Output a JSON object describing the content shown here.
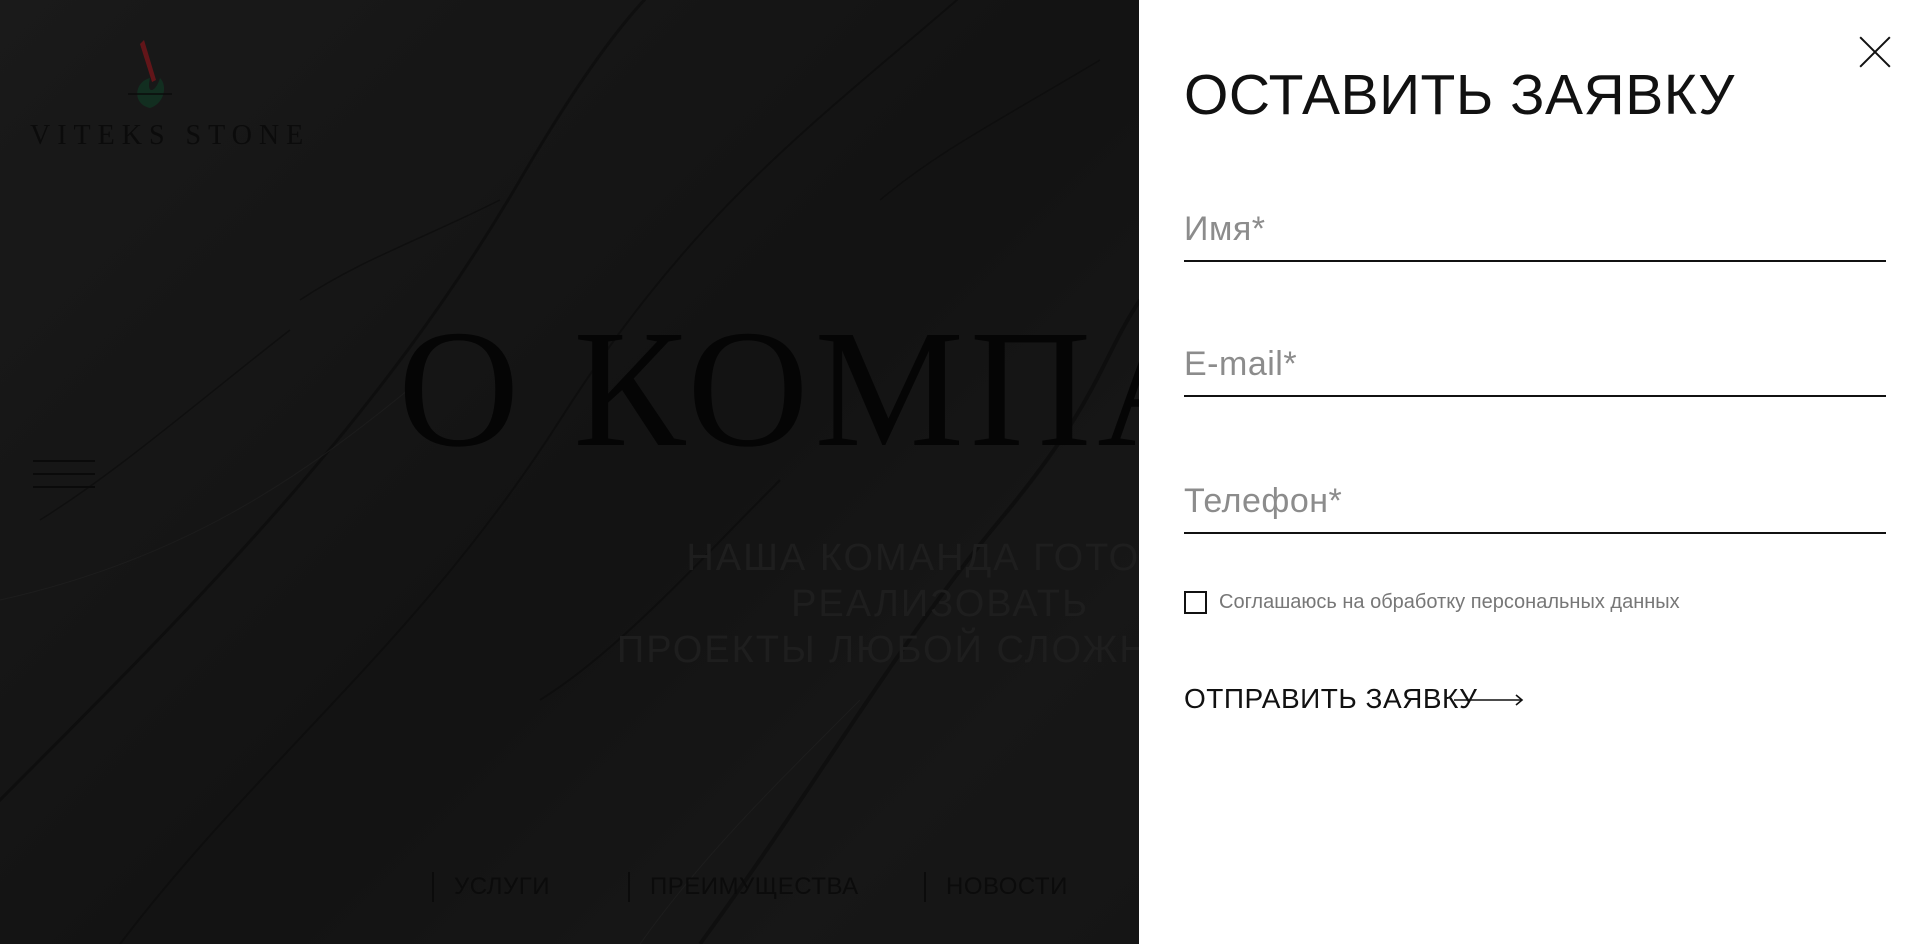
{
  "brand": {
    "logo_text": "VITEKS STONE"
  },
  "hero": {
    "title": "О КОМПАНИИ",
    "subtitle_line1": "НАША КОМАНДА ГОТОВА РЕАЛИЗОВАТЬ",
    "subtitle_line2": "ПРОЕКТЫ ЛЮБОЙ СЛОЖНОСТИ"
  },
  "nav": {
    "items": [
      {
        "label": "УСЛУГИ"
      },
      {
        "label": "ПРЕИМУЩЕСТВА"
      },
      {
        "label": "НОВОСТИ"
      }
    ]
  },
  "modal": {
    "title": "ОСТАВИТЬ ЗАЯВКУ",
    "name_placeholder": "Имя*",
    "email_placeholder": "E-mail*",
    "phone_placeholder": "Телефон*",
    "name_value": "",
    "email_value": "",
    "phone_value": "",
    "consent_label": "Соглашаюсь на обработку персональных данных",
    "consent_checked": false,
    "submit_label": "ОТПРАВИТЬ ЗАЯВКУ"
  },
  "icons": {
    "close": "close-icon",
    "menu": "hamburger-icon",
    "arrow": "arrow-right-icon",
    "logo": "logo-mark-icon"
  },
  "colors": {
    "overlay": "#141414",
    "modal_bg": "#ffffff",
    "text": "#111111",
    "placeholder": "#8c8c8c",
    "logo_red": "#a0141b",
    "logo_green": "#0f3a25"
  }
}
